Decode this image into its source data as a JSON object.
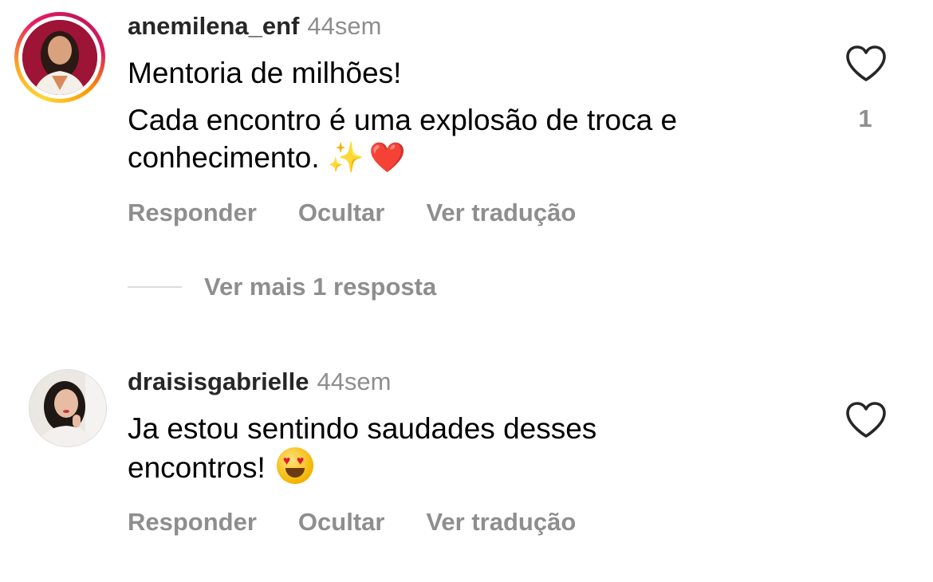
{
  "comments": [
    {
      "username": "anemilena_enf",
      "time": "44sem",
      "lines": [
        "Mentoria de milhões!",
        "Cada encontro é uma explosão de troca e",
        "conhecimento."
      ],
      "emoji": [
        "✨",
        "❤️"
      ],
      "likes": "1",
      "actions": {
        "reply": "Responder",
        "hide": "Ocultar",
        "translate": "Ver tradução"
      },
      "more_replies": "Ver mais 1 resposta",
      "avatar_has_story_ring": true
    },
    {
      "username": "draisisgabrielle",
      "time": "44sem",
      "lines": [
        "Ja estou sentindo saudades desses",
        "encontros!"
      ],
      "emoji": [
        "😍"
      ],
      "actions": {
        "reply": "Responder",
        "hide": "Ocultar",
        "translate": "Ver tradução"
      },
      "avatar_has_story_ring": false
    }
  ],
  "icons": {
    "like": "heart-outline-icon"
  },
  "colors": {
    "secondary_text": "#8e8e8e",
    "primary_text": "#000000",
    "story_ring": [
      "#fdd835",
      "#e91e63",
      "#ff9800"
    ]
  }
}
